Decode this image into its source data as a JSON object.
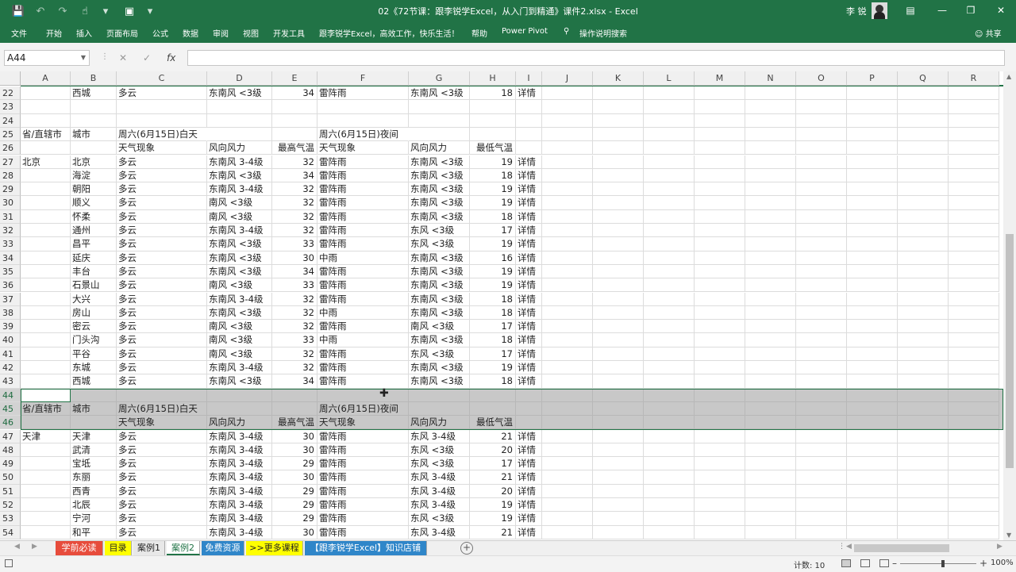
{
  "app": {
    "window_title": "02《72节课：跟李锐学Excel，从入门到精通》课件2.xlsx - Excel",
    "user_name": "李 锐",
    "share_label": "共享",
    "quick_access": [
      "save-icon",
      "undo-icon",
      "redo-icon",
      "touch-mode-icon",
      "customize-icon",
      "camera-icon",
      "more-icon"
    ],
    "window_buttons": [
      "ribbon-display-icon",
      "minimize-icon",
      "restore-icon",
      "close-icon"
    ]
  },
  "ribbon": {
    "tabs": [
      "文件",
      "开始",
      "插入",
      "页面布局",
      "公式",
      "数据",
      "审阅",
      "视图",
      "开发工具",
      "跟李锐学Excel，高效工作，快乐生活！",
      "帮助",
      "Power Pivot"
    ],
    "tell_me": "操作说明搜索"
  },
  "formula_bar": {
    "name_box": "A44",
    "fx_label": "fx",
    "formula": ""
  },
  "columns": [
    "A",
    "B",
    "C",
    "D",
    "E",
    "F",
    "G",
    "H",
    "I",
    "J",
    "K",
    "L",
    "M",
    "N",
    "O",
    "P",
    "Q",
    "R"
  ],
  "rows": [
    {
      "n": "22",
      "c": [
        "",
        "西城",
        "多云",
        "东南风 <3级",
        "34",
        "雷阵雨",
        "东南风 <3级",
        "18",
        "详情"
      ]
    },
    {
      "n": "23",
      "c": [
        "",
        "",
        "",
        "",
        "",
        "",
        "",
        "",
        ""
      ]
    },
    {
      "n": "24",
      "c": [
        "",
        "",
        "",
        "",
        "",
        "",
        "",
        "",
        ""
      ]
    },
    {
      "n": "25",
      "c": [
        "省/直辖市",
        "城市",
        "周六(6月15日)白天",
        "",
        "",
        "周六(6月15日)夜间",
        "",
        "",
        ""
      ]
    },
    {
      "n": "26",
      "c": [
        "",
        "",
        "天气现象",
        "风向风力",
        "最高气温",
        "天气现象",
        "风向风力",
        "最低气温",
        ""
      ]
    },
    {
      "n": "27",
      "c": [
        "北京",
        "北京",
        "多云",
        "东南风 3-4级",
        "32",
        "雷阵雨",
        "东南风 <3级",
        "19",
        "详情"
      ]
    },
    {
      "n": "28",
      "c": [
        "",
        "海淀",
        "多云",
        "东南风 <3级",
        "34",
        "雷阵雨",
        "东南风 <3级",
        "18",
        "详情"
      ]
    },
    {
      "n": "29",
      "c": [
        "",
        "朝阳",
        "多云",
        "东南风 3-4级",
        "32",
        "雷阵雨",
        "东南风 <3级",
        "19",
        "详情"
      ]
    },
    {
      "n": "30",
      "c": [
        "",
        "顺义",
        "多云",
        "南风 <3级",
        "32",
        "雷阵雨",
        "东南风 <3级",
        "19",
        "详情"
      ]
    },
    {
      "n": "31",
      "c": [
        "",
        "怀柔",
        "多云",
        "南风 <3级",
        "32",
        "雷阵雨",
        "东南风 <3级",
        "18",
        "详情"
      ]
    },
    {
      "n": "32",
      "c": [
        "",
        "通州",
        "多云",
        "东南风 3-4级",
        "32",
        "雷阵雨",
        "东风 <3级",
        "17",
        "详情"
      ]
    },
    {
      "n": "33",
      "c": [
        "",
        "昌平",
        "多云",
        "东南风 <3级",
        "33",
        "雷阵雨",
        "东风 <3级",
        "19",
        "详情"
      ]
    },
    {
      "n": "34",
      "c": [
        "",
        "延庆",
        "多云",
        "东南风 <3级",
        "30",
        "中雨",
        "东南风 <3级",
        "16",
        "详情"
      ]
    },
    {
      "n": "35",
      "c": [
        "",
        "丰台",
        "多云",
        "东南风 <3级",
        "34",
        "雷阵雨",
        "东南风 <3级",
        "19",
        "详情"
      ]
    },
    {
      "n": "36",
      "c": [
        "",
        "石景山",
        "多云",
        "南风 <3级",
        "33",
        "雷阵雨",
        "东南风 <3级",
        "19",
        "详情"
      ]
    },
    {
      "n": "37",
      "c": [
        "",
        "大兴",
        "多云",
        "东南风 3-4级",
        "32",
        "雷阵雨",
        "东南风 <3级",
        "18",
        "详情"
      ]
    },
    {
      "n": "38",
      "c": [
        "",
        "房山",
        "多云",
        "东南风 <3级",
        "32",
        "中雨",
        "东南风 <3级",
        "18",
        "详情"
      ]
    },
    {
      "n": "39",
      "c": [
        "",
        "密云",
        "多云",
        "南风 <3级",
        "32",
        "雷阵雨",
        "南风 <3级",
        "17",
        "详情"
      ]
    },
    {
      "n": "40",
      "c": [
        "",
        "门头沟",
        "多云",
        "南风 <3级",
        "33",
        "中雨",
        "东南风 <3级",
        "18",
        "详情"
      ]
    },
    {
      "n": "41",
      "c": [
        "",
        "平谷",
        "多云",
        "南风 <3级",
        "32",
        "雷阵雨",
        "东风 <3级",
        "17",
        "详情"
      ]
    },
    {
      "n": "42",
      "c": [
        "",
        "东城",
        "多云",
        "东南风 3-4级",
        "32",
        "雷阵雨",
        "东南风 <3级",
        "19",
        "详情"
      ]
    },
    {
      "n": "43",
      "c": [
        "",
        "西城",
        "多云",
        "东南风 <3级",
        "34",
        "雷阵雨",
        "东南风 <3级",
        "18",
        "详情"
      ]
    },
    {
      "n": "44",
      "c": [
        "",
        "",
        "",
        "",
        "",
        "",
        "",
        "",
        ""
      ],
      "sel": true
    },
    {
      "n": "45",
      "c": [
        "省/直辖市",
        "城市",
        "周六(6月15日)白天",
        "",
        "",
        "周六(6月15日)夜间",
        "",
        "",
        ""
      ],
      "sel": true
    },
    {
      "n": "46",
      "c": [
        "",
        "",
        "天气现象",
        "风向风力",
        "最高气温",
        "天气现象",
        "风向风力",
        "最低气温",
        ""
      ],
      "sel": true
    },
    {
      "n": "47",
      "c": [
        "天津",
        "天津",
        "多云",
        "东南风 3-4级",
        "30",
        "雷阵雨",
        "东风 3-4级",
        "21",
        "详情"
      ]
    },
    {
      "n": "48",
      "c": [
        "",
        "武清",
        "多云",
        "东南风 3-4级",
        "30",
        "雷阵雨",
        "东风 <3级",
        "20",
        "详情"
      ]
    },
    {
      "n": "49",
      "c": [
        "",
        "宝坻",
        "多云",
        "东南风 3-4级",
        "29",
        "雷阵雨",
        "东风 <3级",
        "17",
        "详情"
      ]
    },
    {
      "n": "50",
      "c": [
        "",
        "东丽",
        "多云",
        "东南风 3-4级",
        "30",
        "雷阵雨",
        "东风 3-4级",
        "21",
        "详情"
      ]
    },
    {
      "n": "51",
      "c": [
        "",
        "西青",
        "多云",
        "东南风 3-4级",
        "29",
        "雷阵雨",
        "东风 3-4级",
        "20",
        "详情"
      ]
    },
    {
      "n": "52",
      "c": [
        "",
        "北辰",
        "多云",
        "东南风 3-4级",
        "29",
        "雷阵雨",
        "东风 3-4级",
        "19",
        "详情"
      ]
    },
    {
      "n": "53",
      "c": [
        "",
        "宁河",
        "多云",
        "东南风 3-4级",
        "29",
        "雷阵雨",
        "东风 <3级",
        "19",
        "详情"
      ]
    },
    {
      "n": "54",
      "c": [
        "",
        "和平",
        "多云",
        "东南风 3-4级",
        "30",
        "雷阵雨",
        "东风 3-4级",
        "21",
        "详情"
      ]
    }
  ],
  "sheet_tabs": [
    {
      "label": "学前必读",
      "bg": "#e74c3c",
      "fg": "#ffffff"
    },
    {
      "label": "目录",
      "bg": "#ffff00",
      "fg": "#222222"
    },
    {
      "label": "案例1",
      "bg": "#e8e8e8",
      "fg": "#222222"
    },
    {
      "label": "案例2",
      "bg": "#ffffff",
      "fg": "#217346",
      "active": true
    },
    {
      "label": "免费资源",
      "bg": "#2f86c9",
      "fg": "#ffffff"
    },
    {
      "label": ">>更多课程",
      "bg": "#ffff00",
      "fg": "#222222"
    },
    {
      "label": "【跟李锐学Excel】知识店铺",
      "bg": "#2f86c9",
      "fg": "#ffffff"
    }
  ],
  "status": {
    "count": "计数: 10",
    "zoom": "100%"
  },
  "colors": {
    "accent": "#217346",
    "selected_rows": "#c8c8c8"
  }
}
